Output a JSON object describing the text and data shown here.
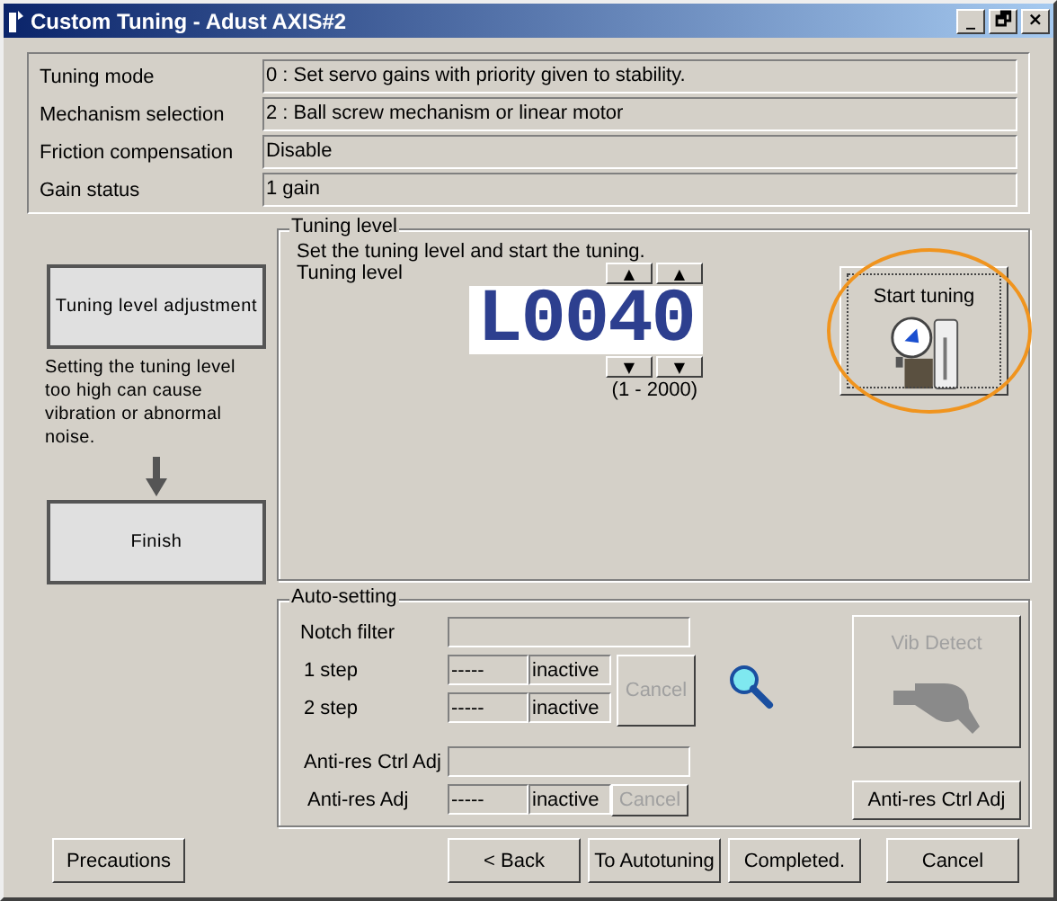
{
  "window": {
    "title": "Custom Tuning - Adust AXIS#2",
    "controls": [
      "_",
      "🗗",
      "×"
    ]
  },
  "settings": [
    {
      "label": "Tuning mode",
      "value": "0 : Set servo gains with priority given to stability."
    },
    {
      "label": "Mechanism selection",
      "value": "2 : Ball screw mechanism or linear motor"
    },
    {
      "label": "Friction compensation",
      "value": "Disable"
    },
    {
      "label": "Gain status",
      "value": "1 gain"
    }
  ],
  "steps": [
    {
      "label": "Tuning level adjustment",
      "note": "Setting the tuning level too high can cause vibration or abnormal noise."
    },
    {
      "label": "Finish"
    }
  ],
  "tuning_level": {
    "group_title": "Tuning level",
    "instruction": "Set the tuning level and start the tuning.",
    "label": "Tuning level",
    "display": "L0040",
    "up_buttons": [
      "▲",
      "▲"
    ],
    "down_buttons": [
      "▼",
      "▼"
    ],
    "range": "(1 - 2000)",
    "start_button": "Start tuning",
    "highlighted": true
  },
  "auto_setting": {
    "group_title": "Auto-setting",
    "notch_label": "Notch filter",
    "steps": [
      {
        "label": "1 step",
        "value": "-----",
        "status": "inactive"
      },
      {
        "label": "2 step",
        "value": "-----",
        "status": "inactive"
      }
    ],
    "steps_cancel": {
      "label": "Cancel",
      "disabled": true
    },
    "anti_res_ctrl_label": "Anti-res Ctrl Adj",
    "anti_res": {
      "label": "Anti-res Adj",
      "value": "-----",
      "status": "inactive"
    },
    "anti_res_cancel": {
      "label": "Cancel",
      "disabled": true
    },
    "vib_detect": {
      "label": "Vib Detect",
      "disabled": true
    },
    "anti_res_ctrl_button": {
      "label": "Anti-res Ctrl Adj",
      "disabled": false
    }
  },
  "buttons": [
    {
      "label": "Precautions"
    },
    {
      "label": "< Back"
    },
    {
      "label": "To Autotuning"
    },
    {
      "label": "Completed."
    },
    {
      "label": "Cancel"
    }
  ]
}
